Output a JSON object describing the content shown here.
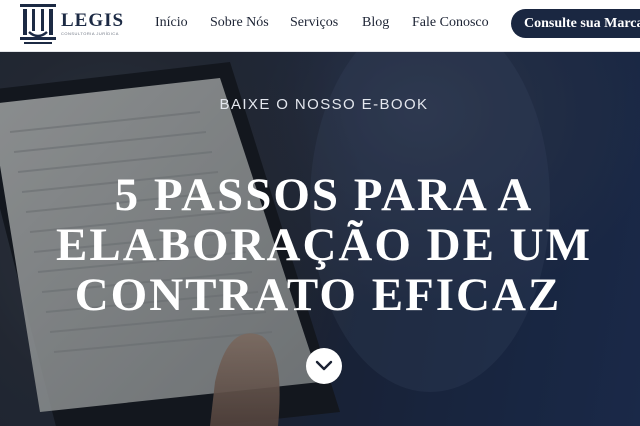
{
  "brand": {
    "name": "LEGIS",
    "tagline": "CONSULTORIA JURÍDICA"
  },
  "nav": {
    "items": [
      {
        "label": "Início"
      },
      {
        "label": "Sobre Nós"
      },
      {
        "label": "Serviços"
      },
      {
        "label": "Blog"
      },
      {
        "label": "Fale Conosco"
      }
    ],
    "cta_label": "Consulte sua Marca"
  },
  "hero": {
    "eyebrow": "BAIXE O NOSSO E-BOOK",
    "title_lines": [
      "5 PASSOS PARA A",
      "ELABORAÇÃO DE UM",
      "CONTRATO EFICAZ"
    ],
    "scroll_icon": "chevron-down-icon"
  },
  "colors": {
    "header_bg": "#ffffff",
    "brand_navy": "#1a2741",
    "hero_text": "#ffffff"
  }
}
